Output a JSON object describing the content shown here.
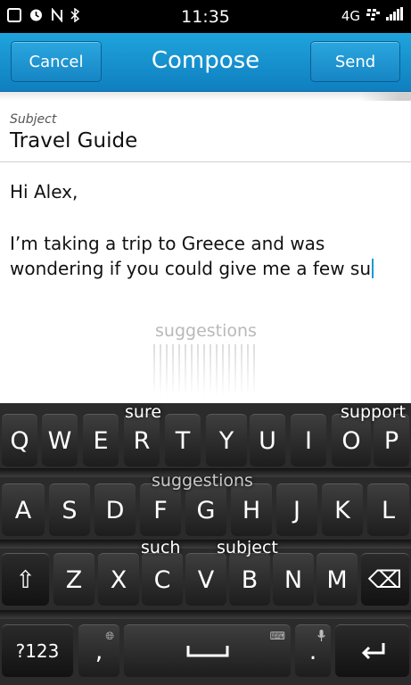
{
  "status_bar": {
    "time": "11:35",
    "network": "4G",
    "icons": [
      "alarm-icon",
      "nfc-icon",
      "bluetooth-icon",
      "bbm-icon",
      "signal-icon"
    ]
  },
  "header": {
    "title": "Compose",
    "cancel_label": "Cancel",
    "send_label": "Send"
  },
  "subject": {
    "label": "Subject",
    "value": "Travel Guide"
  },
  "message": {
    "lines": [
      "Hi Alex,",
      "I’m taking a trip to Greece and was",
      "wondering if you could give me a few su"
    ]
  },
  "floating_suggestion": "suggestions",
  "keyboard": {
    "row1": [
      "Q",
      "W",
      "E",
      "R",
      "T",
      "Y",
      "U",
      "I",
      "O",
      "P"
    ],
    "row2": [
      "A",
      "S",
      "D",
      "F",
      "G",
      "H",
      "J",
      "K",
      "L"
    ],
    "row3": [
      "Z",
      "X",
      "C",
      "V",
      "B",
      "N",
      "M"
    ],
    "symbols_label": "?123",
    "comma_label": ",",
    "period_label": ".",
    "shift_glyph": "⇧",
    "backspace_glyph": "⌫",
    "enter_glyph": "↵",
    "suggestions": {
      "row1_left": "sure",
      "row1_right": "support",
      "row2": "suggestions",
      "row3_left": "such",
      "row3_right": "subject"
    }
  },
  "colors": {
    "accent": "#1a9ad6",
    "titlebar": "#1495d2"
  }
}
